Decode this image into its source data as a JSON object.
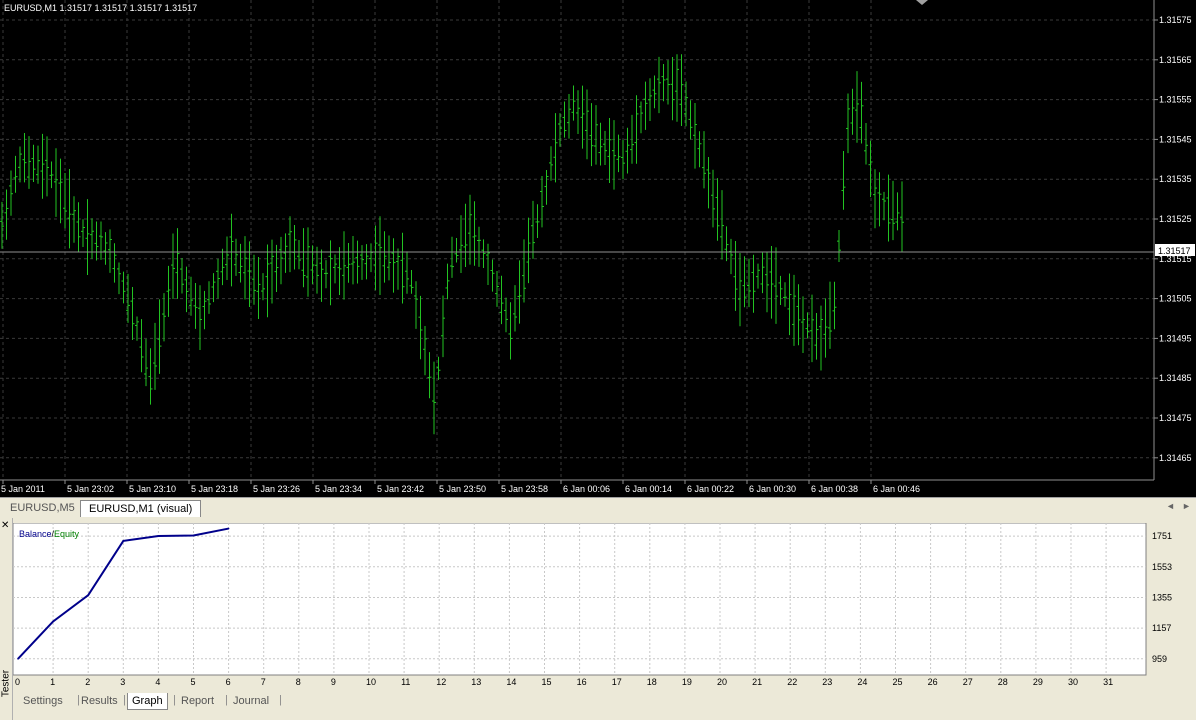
{
  "chart": {
    "header": "EURUSD,M1  1.31517 1.31517 1.31517 1.31517",
    "price_ticks": [
      "1.31575",
      "1.31565",
      "1.31555",
      "1.31545",
      "1.31535",
      "1.31525",
      "1.31515",
      "1.31505",
      "1.31495",
      "1.31485",
      "1.31475",
      "1.31465"
    ],
    "current_price": "1.31517",
    "time_ticks": [
      "5 Jan 2011",
      "5 Jan 23:02",
      "5 Jan 23:10",
      "5 Jan 23:18",
      "5 Jan 23:26",
      "5 Jan 23:34",
      "5 Jan 23:42",
      "5 Jan 23:50",
      "5 Jan 23:58",
      "6 Jan 00:06",
      "6 Jan 00:14",
      "6 Jan 00:22",
      "6 Jan 00:30",
      "6 Jan 00:38",
      "6 Jan 00:46"
    ],
    "colors": {
      "background": "#000000",
      "bars": "#22c322",
      "grid": "#3a3a3a",
      "text": "#ffffff"
    }
  },
  "chart_tabs": [
    {
      "label": "EURUSD,M5",
      "active": false
    },
    {
      "label": "EURUSD,M1 (visual)",
      "active": true
    }
  ],
  "tester": {
    "side_label": "Tester",
    "legend": {
      "balance": "Balance",
      "separator": "/",
      "equity": "Equity"
    },
    "y_ticks": [
      "1751",
      "1553",
      "1355",
      "1157",
      "959"
    ],
    "x_ticks": [
      "0",
      "1",
      "2",
      "3",
      "4",
      "5",
      "6",
      "7",
      "8",
      "9",
      "10",
      "11",
      "12",
      "13",
      "14",
      "15",
      "16",
      "17",
      "18",
      "19",
      "20",
      "21",
      "22",
      "23",
      "24",
      "25",
      "26",
      "27",
      "28",
      "29",
      "30",
      "31"
    ],
    "tabs": [
      {
        "label": "Settings",
        "active": false
      },
      {
        "label": "Results",
        "active": false
      },
      {
        "label": "Graph",
        "active": true
      },
      {
        "label": "Report",
        "active": false
      },
      {
        "label": "Journal",
        "active": false
      }
    ],
    "colors": {
      "balance": "#00008b",
      "equity": "#008000"
    }
  },
  "chart_data": [
    {
      "type": "line",
      "title": "",
      "x": [
        0,
        1,
        2,
        3,
        4,
        5,
        6
      ],
      "series": [
        {
          "name": "Balance",
          "values": [
            959,
            1200,
            1370,
            1720,
            1752,
            1755,
            1800
          ]
        }
      ],
      "xlim": [
        0,
        32
      ],
      "ylim": [
        880,
        1810
      ],
      "y_ticks": [
        959,
        1157,
        1355,
        1553,
        1751
      ],
      "grid": true,
      "legend": "top-left"
    }
  ]
}
